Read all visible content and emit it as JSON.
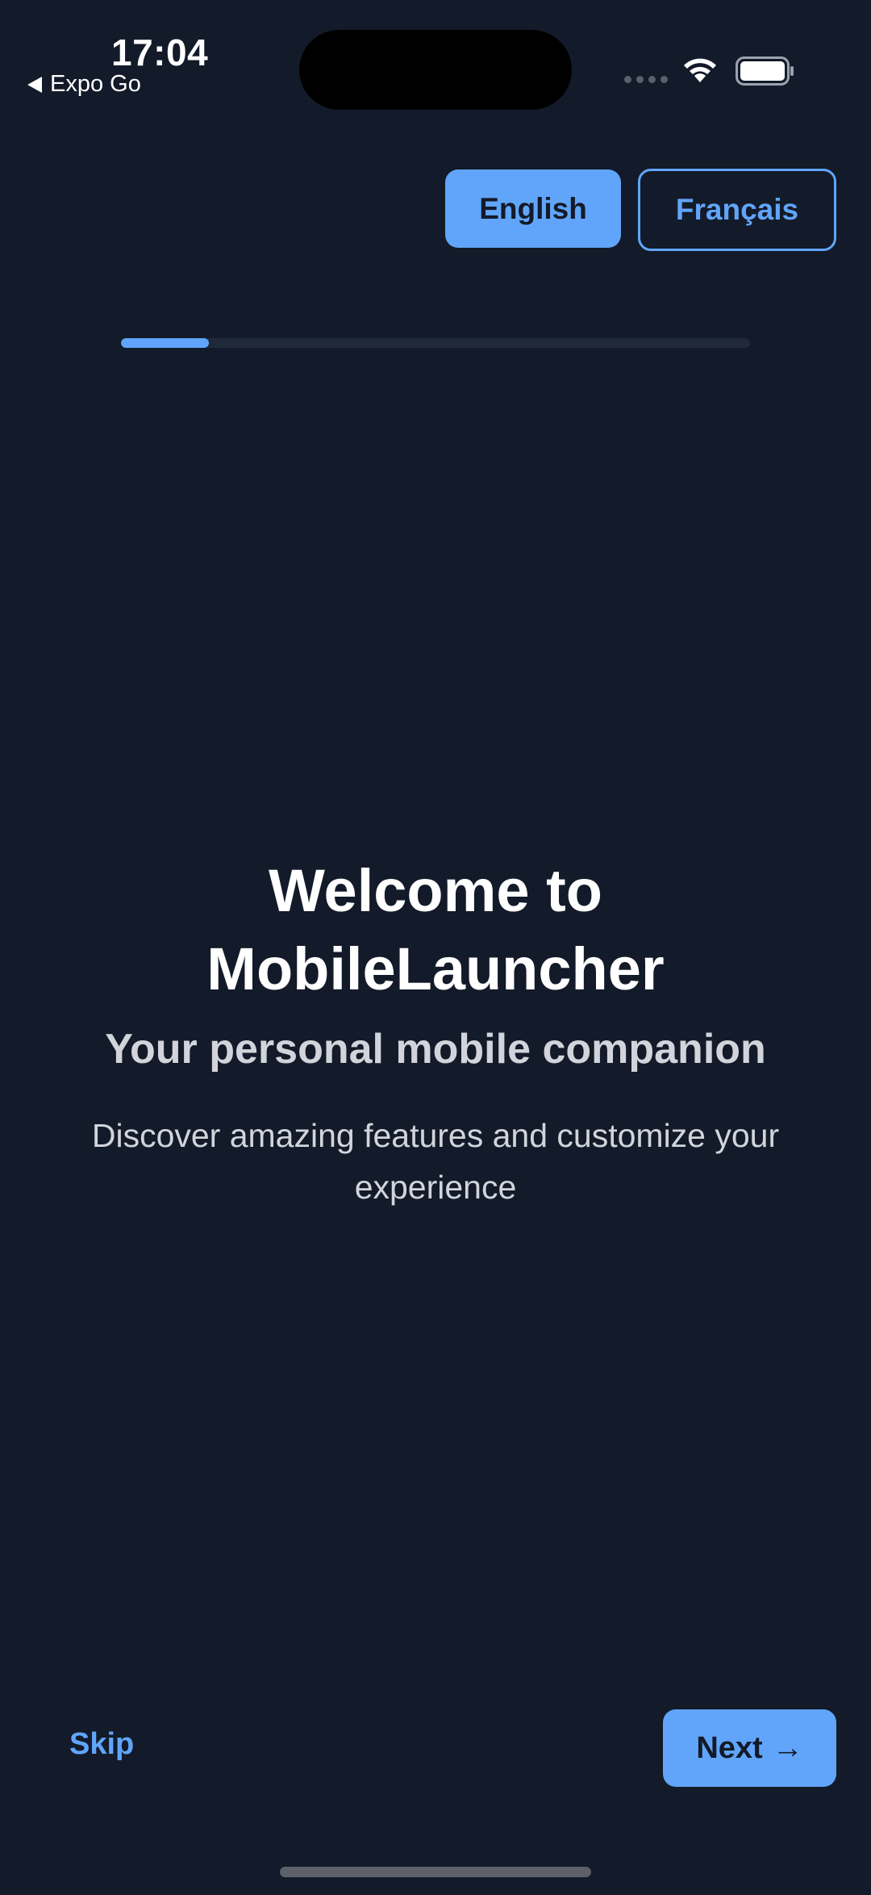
{
  "status_bar": {
    "time": "17:04",
    "back_app": "Expo Go",
    "icons": [
      "cellular-signal-icon",
      "wifi-icon",
      "battery-icon"
    ]
  },
  "language": {
    "options": [
      "English",
      "Français"
    ],
    "selected": "English"
  },
  "progress": {
    "fraction": 0.14
  },
  "onboarding": {
    "title": "Welcome to MobileLauncher",
    "subtitle": "Your personal mobile companion",
    "description": "Discover amazing features and customize your experience"
  },
  "navigation": {
    "skip_label": "Skip",
    "next_label": "Next",
    "next_icon": "→"
  },
  "colors": {
    "background": "#131a29",
    "accent": "#60a5fa",
    "text_primary": "#ffffff",
    "text_secondary": "#d1d5db",
    "track": "#1f2937"
  }
}
